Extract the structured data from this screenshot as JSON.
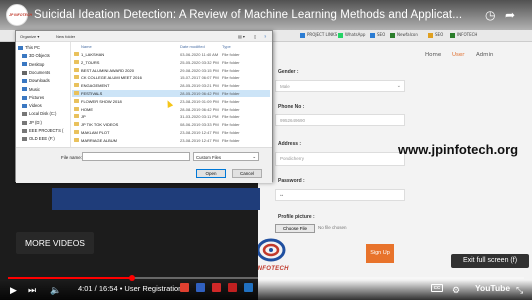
{
  "video": {
    "title": "Suicidal Ideation Detection: A Review of Machine Learning Methods and Applicat...",
    "channel_badge": "JP INFOTECH",
    "time_label": "4:01 / 16:54 • User Registration",
    "more_videos": "MORE VIDEOS",
    "exit_fullscreen": "Exit full screen (f)",
    "cc_label": "CC",
    "youtube_label": "YouTube",
    "progress": 0.24
  },
  "bookmarks": [
    "PROJECT LINKS",
    "WhatsApp",
    "SEO",
    "Newfalcon",
    "SEO",
    "INFOTECH"
  ],
  "site": {
    "nav": [
      "Home",
      "User",
      "Admin"
    ],
    "active_nav": "User",
    "form": {
      "gender_label": "Gender :",
      "gender_value": "Male",
      "phone_label": "Phone No :",
      "phone_value": "9952649690",
      "address_label": "Address :",
      "address_value": "Pondicherry",
      "password_label": "Password :",
      "password_value": "••",
      "picture_label": "Profile picture :",
      "choose_file": "Choose File",
      "no_file": "No file chosen",
      "signup": "Sign Up"
    },
    "logo_text": "JP INFOTECH",
    "watermark": "www.jpinfotech.org"
  },
  "dialog": {
    "toolbar": {
      "organize": "Organize ▾",
      "new_folder": "New folder"
    },
    "nav_items": [
      {
        "label": "This PC",
        "color": "#3a78c2"
      },
      {
        "label": "3D Objects",
        "color": "#3a78c2"
      },
      {
        "label": "Desktop",
        "color": "#3a78c2"
      },
      {
        "label": "Documents",
        "color": "#666"
      },
      {
        "label": "Downloads",
        "color": "#3a78c2"
      },
      {
        "label": "Music",
        "color": "#3a78c2"
      },
      {
        "label": "Pictures",
        "color": "#3a78c2"
      },
      {
        "label": "Videos",
        "color": "#3a78c2"
      },
      {
        "label": "Local Disk (C:)",
        "color": "#777"
      },
      {
        "label": "JP (D:)",
        "color": "#777"
      },
      {
        "label": "EEE PROJECTS (",
        "color": "#777"
      },
      {
        "label": "OLD EEE (F:)",
        "color": "#777"
      }
    ],
    "columns": {
      "name": "Name",
      "date": "Date modified",
      "type": "Type"
    },
    "files": [
      {
        "name": "1_LAKSHAN",
        "date": "03-06-2020 11:40 AM",
        "type": "File folder"
      },
      {
        "name": "2_TOURS",
        "date": "25-05-2020 03:32 PM",
        "type": "File folder"
      },
      {
        "name": "BEST ALUMINI AWARD 2020",
        "date": "29-08-2020 03:15 PM",
        "type": "File folder"
      },
      {
        "name": "CK COLLEGE ALUMI MEET 2016",
        "date": "15-07-2017 06:07 PM",
        "type": "File folder"
      },
      {
        "name": "ENGAGEMENT",
        "date": "28-05-2019 03:21 PM",
        "type": "File folder"
      },
      {
        "name": "FESTIVALS",
        "date": "28-05-2019 06:42 PM",
        "type": "File folder"
      },
      {
        "name": "FLOWER SHOW 2018",
        "date": "23-08-2019 01:09 PM",
        "type": "File folder"
      },
      {
        "name": "HOME",
        "date": "28-08-2019 06:42 PM",
        "type": "File folder"
      },
      {
        "name": "JP",
        "date": "31-03-2020 03:11 PM",
        "type": "File folder"
      },
      {
        "name": "JP TIK TOK VIDEOS",
        "date": "08-06-2019 03:33 PM",
        "type": "File folder"
      },
      {
        "name": "MAKLAM PLOT",
        "date": "23-08-2019 12:47 PM",
        "type": "File folder"
      },
      {
        "name": "MARRIAGE ALBUM",
        "date": "23-08-2019 12:47 PM",
        "type": "File folder"
      }
    ],
    "selected_index": 5,
    "file_name_label": "File name:",
    "file_type": "Custom Files",
    "open": "Open",
    "cancel": "Cancel"
  }
}
